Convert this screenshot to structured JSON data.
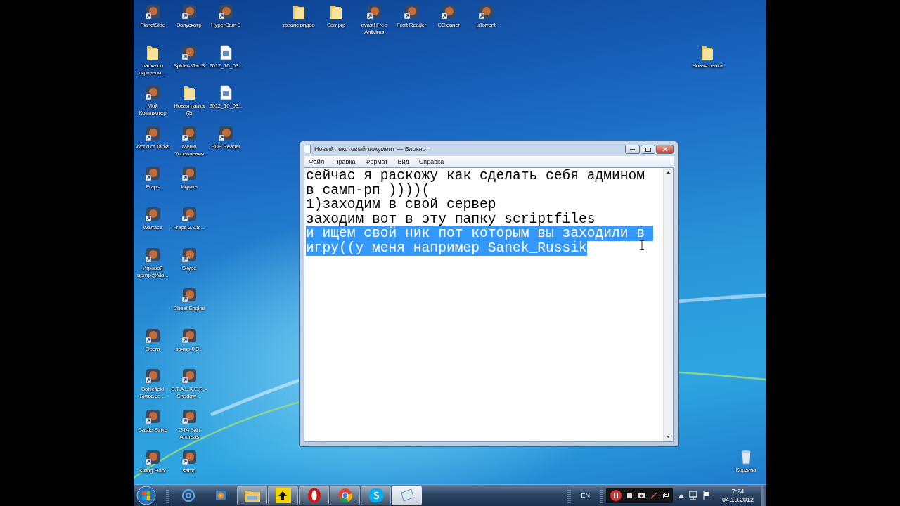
{
  "desktop": {
    "icons": [
      {
        "label": "PlanetSide",
        "kind": "app"
      },
      {
        "label": "Запускатр",
        "kind": "app"
      },
      {
        "label": "HyperCam 3",
        "kind": "app"
      },
      {
        "label": "фрапс видео",
        "kind": "folder"
      },
      {
        "label": "Samprp",
        "kind": "folder"
      },
      {
        "label": "avast! Free Antivirus",
        "kind": "app"
      },
      {
        "label": "Foxit Reader",
        "kind": "app"
      },
      {
        "label": "CCleaner",
        "kind": "app"
      },
      {
        "label": "µTorrent",
        "kind": "app"
      },
      {
        "label": "папка со скринапи ...",
        "kind": "folder"
      },
      {
        "label": "Spider-Man 3",
        "kind": "app"
      },
      {
        "label": "2012_10_03...",
        "kind": "file"
      },
      {
        "label": "Новая папка",
        "kind": "folder"
      },
      {
        "label": "Мой Компьютер",
        "kind": "app"
      },
      {
        "label": "Новая папка (2)",
        "kind": "folder"
      },
      {
        "label": "2012_10_03...",
        "kind": "file"
      },
      {
        "label": "World of Tanks",
        "kind": "app"
      },
      {
        "label": "Меню Управления",
        "kind": "app"
      },
      {
        "label": "PDF Reader",
        "kind": "app"
      },
      {
        "label": "Fraps",
        "kind": "app"
      },
      {
        "label": "Играть",
        "kind": "app"
      },
      {
        "label": "Warface",
        "kind": "app"
      },
      {
        "label": "Fraps-2.9.8-...",
        "kind": "app"
      },
      {
        "label": "Игровой центр@Ma...",
        "kind": "app"
      },
      {
        "label": "Skype",
        "kind": "app"
      },
      {
        "label": "Cheat Engine",
        "kind": "app"
      },
      {
        "label": "Opera",
        "kind": "app"
      },
      {
        "label": "sa-mp-0.3...",
        "kind": "app"
      },
      {
        "label": "Battlefield Битва за ...",
        "kind": "app"
      },
      {
        "label": "S.T.A.L.K.E.R. - Shadow ...",
        "kind": "app"
      },
      {
        "label": "Castle Strike",
        "kind": "app"
      },
      {
        "label": "GTA San Andreas",
        "kind": "app"
      },
      {
        "label": "Killing Floor",
        "kind": "app"
      },
      {
        "label": "samp",
        "kind": "app"
      },
      {
        "label": "Корзина",
        "kind": "bin"
      }
    ]
  },
  "notepad": {
    "title": "Новый текстовый документ — Блокнот",
    "menu": [
      "Файл",
      "Правка",
      "Формат",
      "Вид",
      "Справка"
    ],
    "lines": [
      {
        "text": "сейчас я раскожу как сделать себя админом",
        "selected": false
      },
      {
        "text": "в самп-рп ))))(",
        "selected": false
      },
      {
        "text": "1)заходим в свой сервер",
        "selected": false
      },
      {
        "text": "заходим вот в эту папку scriptfiles",
        "selected": false
      },
      {
        "text": "и ищем свой ник пот которым вы заходили в ",
        "selected": true
      },
      {
        "text": "игру((у меня например Sanek_Russik",
        "selected": true
      }
    ]
  },
  "taskbar": {
    "buttons": [
      {
        "kind": "explorer",
        "active": false
      },
      {
        "kind": "app",
        "active": false
      },
      {
        "kind": "opera",
        "active": false
      },
      {
        "kind": "chrome",
        "active": false
      },
      {
        "kind": "skype",
        "active": false
      },
      {
        "kind": "notepad",
        "active": true
      }
    ],
    "language": "EN",
    "time": "7:24",
    "date": "04.10.2012"
  }
}
